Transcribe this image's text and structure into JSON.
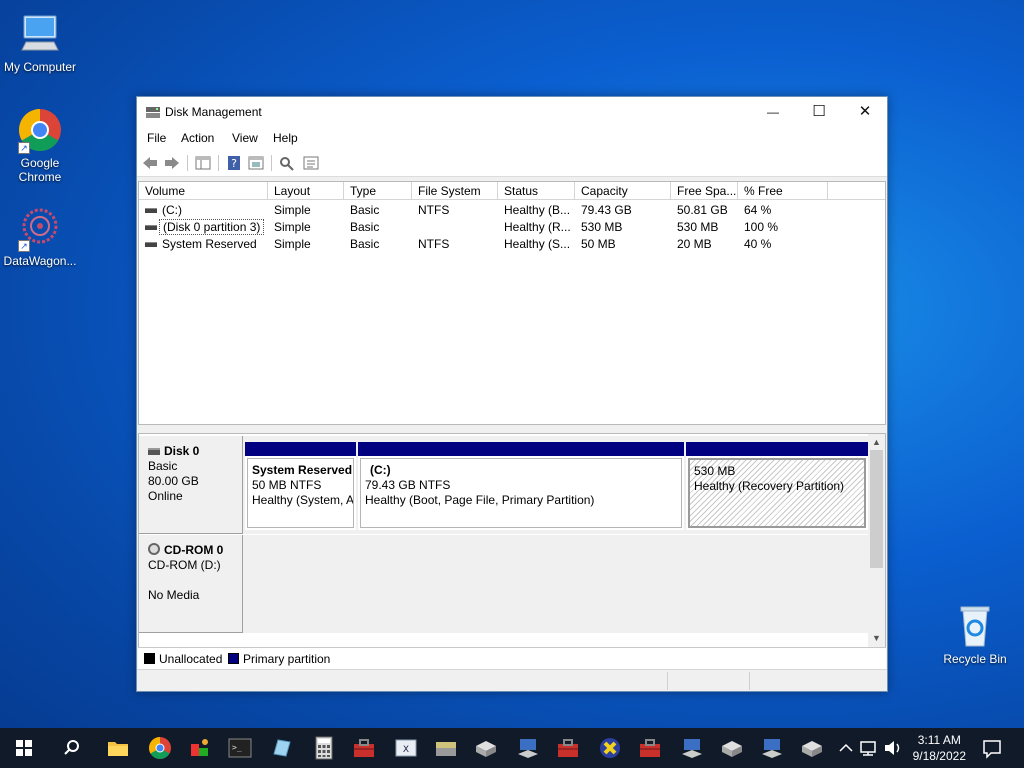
{
  "desktop": {
    "icons": [
      {
        "label": "My Computer"
      },
      {
        "label": "Google Chrome"
      },
      {
        "label": "DataWagon..."
      },
      {
        "label": "Recycle Bin"
      }
    ]
  },
  "window": {
    "title": "Disk Management",
    "controls": {
      "minimize": "—",
      "maximize": "☐",
      "close": "✕"
    },
    "menu": [
      "File",
      "Action",
      "View",
      "Help"
    ],
    "toolbar_icons": [
      "back-arrow-icon",
      "forward-arrow-icon",
      "show-hide-console-tree-icon",
      "help-icon",
      "properties-icon",
      "rescan-icon",
      "list-view-icon"
    ]
  },
  "volume_list": {
    "columns": [
      "Volume",
      "Layout",
      "Type",
      "File System",
      "Status",
      "Capacity",
      "Free Spa...",
      "% Free"
    ],
    "rows": [
      [
        "(C:)",
        "Simple",
        "Basic",
        "NTFS",
        "Healthy (B...",
        "79.43 GB",
        "50.81 GB",
        "64 %"
      ],
      [
        "(Disk 0 partition 3)",
        "Simple",
        "Basic",
        "",
        "Healthy (R...",
        "530 MB",
        "530 MB",
        "100 %"
      ],
      [
        "System Reserved",
        "Simple",
        "Basic",
        "NTFS",
        "Healthy (S...",
        "50 MB",
        "20 MB",
        "40 %"
      ]
    ]
  },
  "disks": {
    "disk0": {
      "name": "Disk 0",
      "type": "Basic",
      "size": "80.00 GB",
      "state": "Online",
      "partitions": [
        {
          "title": "System Reserved",
          "size": "50 MB NTFS",
          "status": "Healthy (System, A"
        },
        {
          "title": "(C:)",
          "size": "79.43 GB NTFS",
          "status": "Healthy (Boot, Page File, Primary Partition)"
        },
        {
          "title": "",
          "size": "530 MB",
          "status": "Healthy (Recovery Partition)"
        }
      ]
    },
    "cdrom0": {
      "name": "CD-ROM 0",
      "drive": "CD-ROM (D:)",
      "media": "No Media"
    }
  },
  "legend": {
    "unallocated": "Unallocated",
    "primary": "Primary partition",
    "colors": {
      "unallocated": "#000000",
      "primary": "#000080"
    }
  },
  "taskbar": {
    "time": "3:11 AM",
    "date": "9/18/2022",
    "pinned": [
      "windows-start-icon",
      "search-icon",
      "file-explorer-icon",
      "chrome-icon",
      "app-icon",
      "terminal-icon",
      "app-icon",
      "calculator-icon",
      "toolbox-icon",
      "app-icon",
      "app-icon",
      "app-icon",
      "app-icon",
      "toolbox-icon",
      "app-icon",
      "toolbox-icon",
      "app-icon",
      "app-icon",
      "app-icon",
      "app-icon"
    ]
  }
}
